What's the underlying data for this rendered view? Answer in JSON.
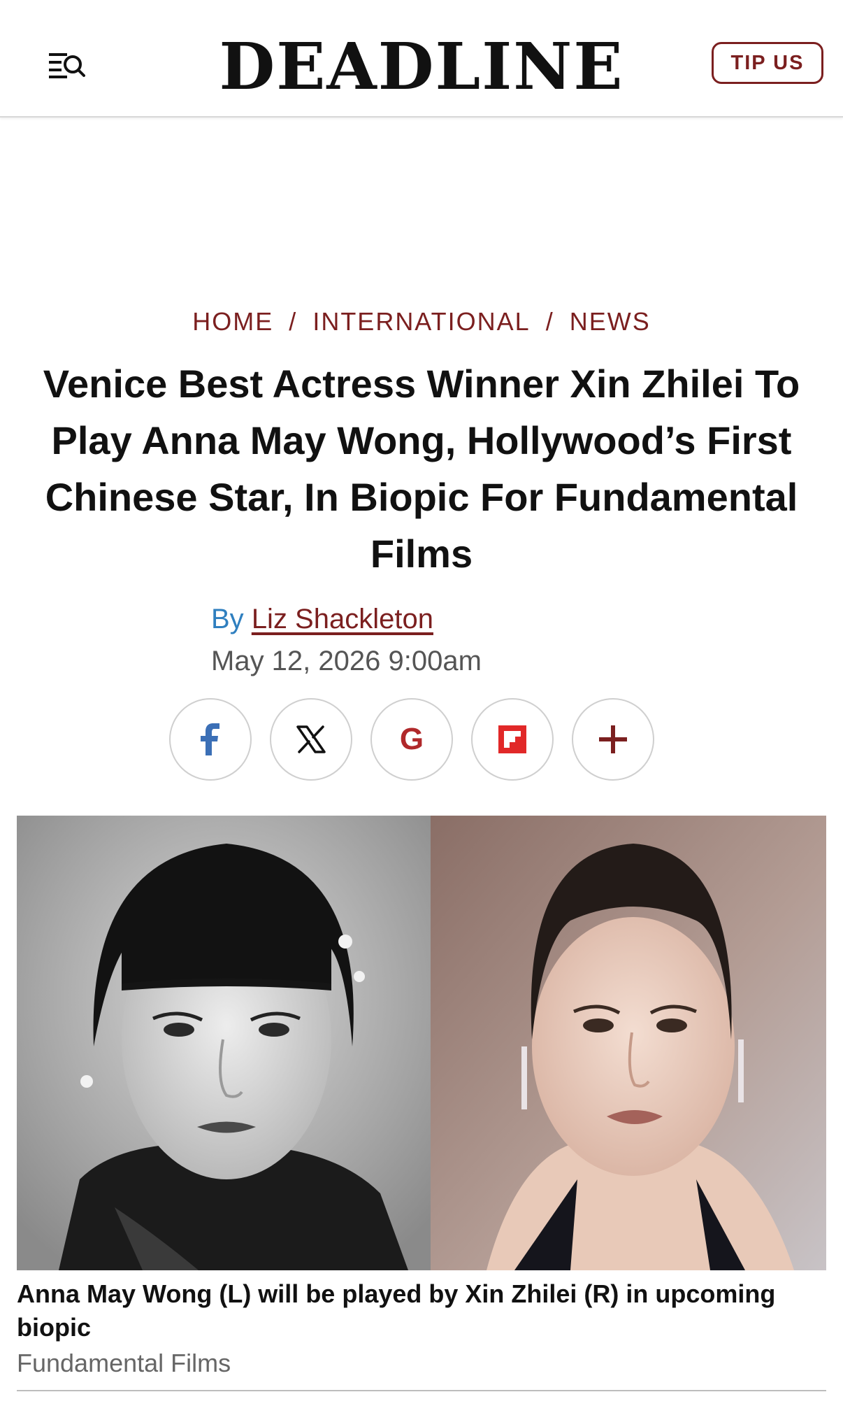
{
  "header": {
    "logo": "DEADLINE",
    "tip_label": "TIP US",
    "menu_icon": "menu-search-icon"
  },
  "colors": {
    "brand": "#7b1f1f",
    "byline_blue": "#2f7fbf",
    "facebook": "#3b6fb6",
    "google": "#b0282a",
    "flipboard": "#e12828"
  },
  "breadcrumb": {
    "items": [
      "HOME",
      "INTERNATIONAL",
      "NEWS"
    ],
    "separator": "/"
  },
  "article": {
    "headline": "Venice Best Actress Winner Xin Zhilei To Play Anna May Wong, Hollywood’s First Chinese Star, In Biopic For Fundamental Films",
    "by_prefix": "By",
    "author": "Liz Shackleton",
    "date": "May 12, 2026 9:00am"
  },
  "share": {
    "buttons": [
      "facebook-icon",
      "x-icon",
      "google-icon",
      "flipboard-icon",
      "plus-icon"
    ],
    "google_letter": "G"
  },
  "image": {
    "caption": "Anna May Wong (L) will be played by Xin Zhilei (R) in upcoming biopic",
    "credit": "Fundamental Films"
  }
}
